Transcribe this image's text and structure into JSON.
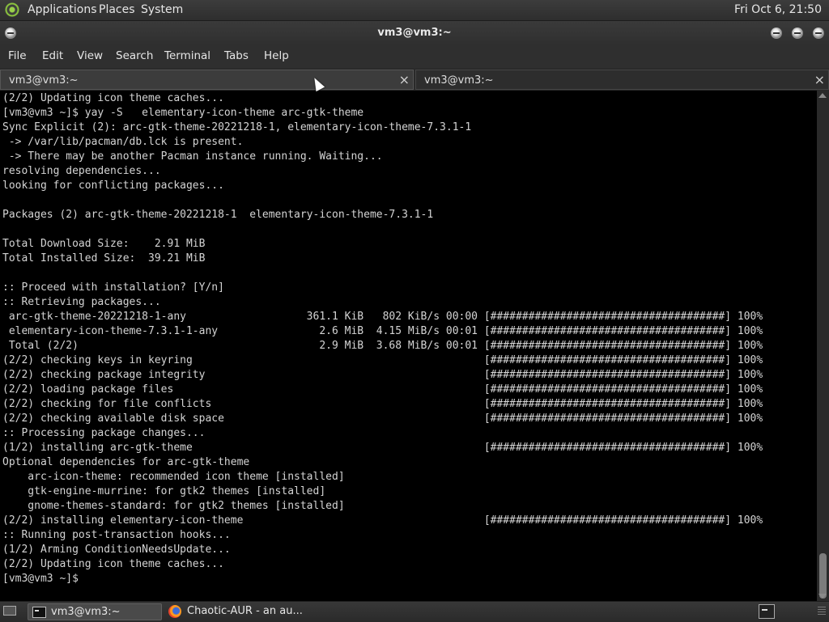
{
  "top_panel": {
    "applications": "Applications",
    "places": "Places",
    "system": "System",
    "clock": "Fri Oct  6, 21:50",
    "logo_icon": "distro-logo-icon"
  },
  "window": {
    "title": "vm3@vm3:~"
  },
  "menubar": {
    "items": [
      "File",
      "Edit",
      "View",
      "Search",
      "Terminal",
      "Tabs",
      "Help"
    ]
  },
  "tabs": [
    {
      "label": "vm3@vm3:~",
      "close": "×",
      "active": true
    },
    {
      "label": "vm3@vm3:~",
      "close": "×",
      "active": false
    }
  ],
  "terminal": {
    "lines": [
      "(2/2) Updating icon theme caches...",
      "[vm3@vm3 ~]$ yay -S   elementary-icon-theme arc-gtk-theme",
      "Sync Explicit (2): arc-gtk-theme-20221218-1, elementary-icon-theme-7.3.1-1",
      " -> /var/lib/pacman/db.lck is present.",
      " -> There may be another Pacman instance running. Waiting...",
      "resolving dependencies...",
      "looking for conflicting packages...",
      "",
      "Packages (2) arc-gtk-theme-20221218-1  elementary-icon-theme-7.3.1-1",
      "",
      "Total Download Size:    2.91 MiB",
      "Total Installed Size:  39.21 MiB",
      "",
      ":: Proceed with installation? [Y/n]",
      ":: Retrieving packages...",
      " arc-gtk-theme-20221218-1-any                   361.1 KiB   802 KiB/s 00:00 [#####################################] 100%",
      " elementary-icon-theme-7.3.1-1-any                2.6 MiB  4.15 MiB/s 00:01 [#####################################] 100%",
      " Total (2/2)                                      2.9 MiB  3.68 MiB/s 00:01 [#####################################] 100%",
      "(2/2) checking keys in keyring                                              [#####################################] 100%",
      "(2/2) checking package integrity                                            [#####################################] 100%",
      "(2/2) loading package files                                                 [#####################################] 100%",
      "(2/2) checking for file conflicts                                           [#####################################] 100%",
      "(2/2) checking available disk space                                         [#####################################] 100%",
      ":: Processing package changes...",
      "(1/2) installing arc-gtk-theme                                              [#####################################] 100%",
      "Optional dependencies for arc-gtk-theme",
      "    arc-icon-theme: recommended icon theme [installed]",
      "    gtk-engine-murrine: for gtk2 themes [installed]",
      "    gnome-themes-standard: for gtk2 themes [installed]",
      "(2/2) installing elementary-icon-theme                                      [#####################################] 100%",
      ":: Running post-transaction hooks...",
      "(1/2) Arming ConditionNeedsUpdate...",
      "(2/2) Updating icon theme caches...",
      "[vm3@vm3 ~]$"
    ]
  },
  "taskbar": {
    "items": [
      {
        "label": "vm3@vm3:~",
        "icon": "terminal-icon",
        "active": true
      },
      {
        "label": "Chaotic-AUR - an au...",
        "icon": "firefox-icon",
        "active": false
      }
    ],
    "show_desktop_icon": "show-desktop-icon",
    "tray_icon": "terminal-tray-icon"
  },
  "colors": {
    "terminal_bg": "#000000",
    "terminal_fg": "#d4d4d4",
    "panel_bg": "#2e2e2e"
  }
}
